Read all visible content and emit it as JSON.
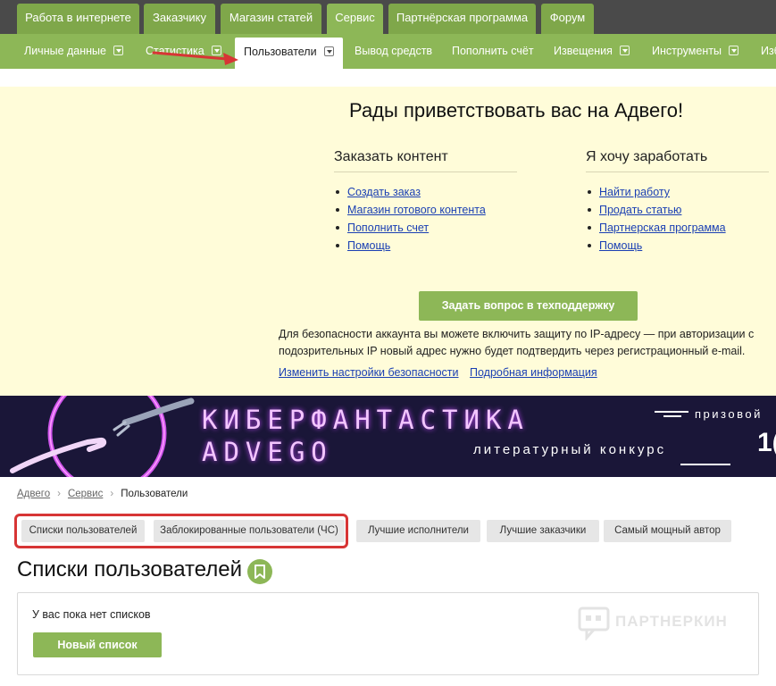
{
  "top_nav": [
    {
      "label": "Работа в интернете"
    },
    {
      "label": "Заказчику"
    },
    {
      "label": "Магазин статей"
    },
    {
      "label": "Сервис"
    },
    {
      "label": "Партнёрская программа"
    },
    {
      "label": "Форум"
    }
  ],
  "sub_nav": [
    {
      "label": "Личные данные"
    },
    {
      "label": "Статистика"
    },
    {
      "label": "Пользователи"
    },
    {
      "label": "Вывод средств"
    },
    {
      "label": "Пополнить счёт"
    },
    {
      "label": "Извещения"
    },
    {
      "label": "Инструменты"
    },
    {
      "label": "Изб"
    }
  ],
  "welcome": {
    "title": "Рады приветствовать вас на Адвего!",
    "order": {
      "title": "Заказать контент",
      "links": [
        "Создать заказ",
        "Магазин готового контента",
        "Пополнить счет",
        "Помощь"
      ]
    },
    "earn": {
      "title": "Я хочу заработать",
      "links": [
        "Найти работу",
        "Продать статью",
        "Партнерская программа",
        "Помощь"
      ]
    },
    "support_button": "Задать вопрос в техподдержку",
    "security_text": "Для безопасности аккаунта вы можете включить защиту по IP-адресу — при авторизации с подозрительных IP новый адрес нужно будет подтвердить через регистрационный e-mail.",
    "security_links": [
      "Изменить настройки безопасности",
      "Подробная информация"
    ]
  },
  "banner": {
    "title": "КИБЕРФАНТАСТИКА",
    "brand": "ADVEGO",
    "subtitle": "литературный конкурс",
    "prize": "призовой",
    "number": "1("
  },
  "breadcrumb": [
    "Адвего",
    "Сервис",
    "Пользователи"
  ],
  "tabs": [
    {
      "label": "Списки пользователей"
    },
    {
      "label": "Заблокированные пользователи (ЧС)"
    },
    {
      "label": "Лучшие исполнители"
    },
    {
      "label": "Лучшие заказчики"
    },
    {
      "label": "Самый мощный автор"
    }
  ],
  "lists": {
    "title": "Списки пользователей",
    "empty_text": "У вас пока нет списков",
    "new_button": "Новый список"
  },
  "watermark": "ПАРТНЕРКИН",
  "colors": {
    "green": "#8db757",
    "dark_nav": "#4a4a4a",
    "highlight_red": "#d73535",
    "welcome_bg": "#fffcd9"
  }
}
